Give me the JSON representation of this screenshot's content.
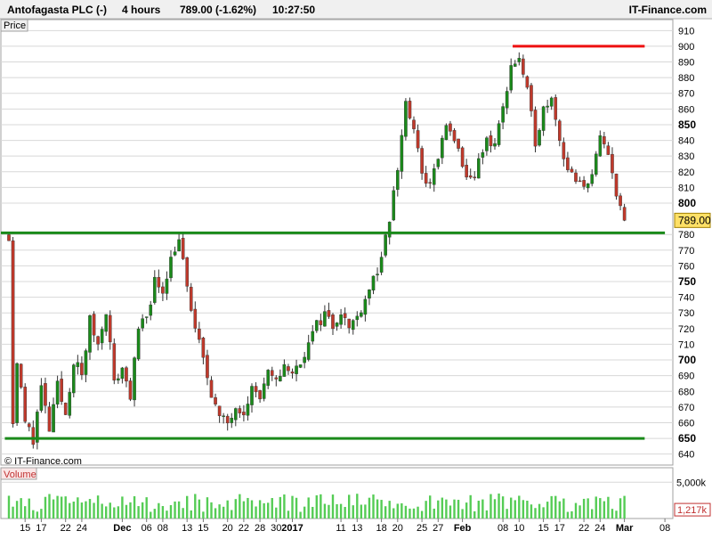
{
  "header": {
    "instrument": "Antofagasta PLC (-)",
    "timeframe": "4 hours",
    "quote": "789.00 (-1.62%)",
    "time": "10:27:50",
    "brand": "IT-Finance.com"
  },
  "watermark": "© IT-Finance.com",
  "colors": {
    "up_candle": "#1a8a1a",
    "down_candle": "#c0392b",
    "support_line": "#1a8a1a",
    "resistance_line": "#ee1111",
    "volume_bar": "#55cc55",
    "grid": "#d8d8d8",
    "axis_text": "#000000"
  },
  "chart_data": [
    {
      "type": "candlestick",
      "name": "price-panel",
      "panel_label": "Price",
      "ylim": [
        633,
        917
      ],
      "y_ticks": [
        640,
        650,
        660,
        670,
        680,
        690,
        700,
        710,
        720,
        730,
        740,
        750,
        760,
        770,
        780,
        789,
        800,
        810,
        820,
        830,
        840,
        850,
        860,
        870,
        880,
        890,
        900,
        910
      ],
      "y_major_ticks": [
        650,
        700,
        750,
        800,
        850
      ],
      "x_ticks": [
        {
          "label": "15",
          "session": 2
        },
        {
          "label": "17",
          "session": 4
        },
        {
          "label": "22",
          "session": 7
        },
        {
          "label": "24",
          "session": 9
        },
        {
          "label": "Dec",
          "session": 14,
          "bold": true
        },
        {
          "label": "06",
          "session": 17
        },
        {
          "label": "08",
          "session": 19
        },
        {
          "label": "13",
          "session": 22
        },
        {
          "label": "15",
          "session": 24
        },
        {
          "label": "20",
          "session": 27
        },
        {
          "label": "22",
          "session": 29
        },
        {
          "label": "28",
          "session": 31
        },
        {
          "label": "30",
          "session": 33
        },
        {
          "label": "2017",
          "session": 35,
          "bold": true
        },
        {
          "label": "11",
          "session": 41
        },
        {
          "label": "13",
          "session": 43
        },
        {
          "label": "18",
          "session": 46
        },
        {
          "label": "20",
          "session": 48
        },
        {
          "label": "25",
          "session": 51
        },
        {
          "label": "27",
          "session": 53
        },
        {
          "label": "Feb",
          "session": 56,
          "bold": true
        },
        {
          "label": "08",
          "session": 61
        },
        {
          "label": "10",
          "session": 63
        },
        {
          "label": "15",
          "session": 66
        },
        {
          "label": "17",
          "session": 68
        },
        {
          "label": "22",
          "session": 71
        },
        {
          "label": "24",
          "session": 73
        },
        {
          "label": "Mar",
          "session": 76,
          "bold": true
        },
        {
          "label": "08",
          "session": 81
        }
      ],
      "bars_per_session": 2,
      "anchors": [
        {
          "session": 0,
          "price": 780
        },
        {
          "session": 0.5,
          "price": 660
        },
        {
          "session": 1,
          "price": 700
        },
        {
          "session": 2,
          "price": 660
        },
        {
          "session": 3,
          "price": 650
        },
        {
          "session": 4,
          "price": 682
        },
        {
          "session": 5,
          "price": 655
        },
        {
          "session": 6,
          "price": 683
        },
        {
          "session": 7,
          "price": 665
        },
        {
          "session": 8,
          "price": 700
        },
        {
          "session": 9,
          "price": 690
        },
        {
          "session": 10,
          "price": 725
        },
        {
          "session": 11,
          "price": 710
        },
        {
          "session": 12,
          "price": 733
        },
        {
          "session": 13,
          "price": 685
        },
        {
          "session": 14,
          "price": 695
        },
        {
          "session": 15,
          "price": 678
        },
        {
          "session": 16,
          "price": 718
        },
        {
          "session": 17,
          "price": 728
        },
        {
          "session": 18,
          "price": 750
        },
        {
          "session": 19,
          "price": 745
        },
        {
          "session": 20,
          "price": 765
        },
        {
          "session": 21,
          "price": 778
        },
        {
          "session": 22,
          "price": 745
        },
        {
          "session": 23,
          "price": 720
        },
        {
          "session": 24,
          "price": 700
        },
        {
          "session": 25,
          "price": 680
        },
        {
          "session": 26,
          "price": 662
        },
        {
          "session": 27,
          "price": 660
        },
        {
          "session": 28,
          "price": 672
        },
        {
          "session": 29,
          "price": 668
        },
        {
          "session": 30,
          "price": 682
        },
        {
          "session": 31,
          "price": 676
        },
        {
          "session": 32,
          "price": 690
        },
        {
          "session": 33,
          "price": 685
        },
        {
          "session": 34,
          "price": 698
        },
        {
          "session": 35,
          "price": 690
        },
        {
          "session": 36,
          "price": 700
        },
        {
          "session": 37,
          "price": 710
        },
        {
          "session": 38,
          "price": 722
        },
        {
          "session": 39,
          "price": 730
        },
        {
          "session": 40,
          "price": 722
        },
        {
          "session": 41,
          "price": 732
        },
        {
          "session": 42,
          "price": 720
        },
        {
          "session": 43,
          "price": 728
        },
        {
          "session": 44,
          "price": 740
        },
        {
          "session": 45,
          "price": 752
        },
        {
          "session": 46,
          "price": 762
        },
        {
          "session": 47,
          "price": 790
        },
        {
          "session": 48,
          "price": 822
        },
        {
          "session": 49,
          "price": 865
        },
        {
          "session": 50,
          "price": 845
        },
        {
          "session": 51,
          "price": 820
        },
        {
          "session": 52,
          "price": 810
        },
        {
          "session": 53,
          "price": 830
        },
        {
          "session": 54,
          "price": 848
        },
        {
          "session": 55,
          "price": 842
        },
        {
          "session": 56,
          "price": 820
        },
        {
          "session": 57,
          "price": 815
        },
        {
          "session": 58,
          "price": 825
        },
        {
          "session": 59,
          "price": 840
        },
        {
          "session": 60,
          "price": 838
        },
        {
          "session": 61,
          "price": 860
        },
        {
          "session": 62,
          "price": 888
        },
        {
          "session": 63,
          "price": 892
        },
        {
          "session": 64,
          "price": 870
        },
        {
          "session": 65,
          "price": 840
        },
        {
          "session": 66,
          "price": 860
        },
        {
          "session": 67,
          "price": 870
        },
        {
          "session": 68,
          "price": 840
        },
        {
          "session": 69,
          "price": 822
        },
        {
          "session": 70,
          "price": 812
        },
        {
          "session": 71,
          "price": 810
        },
        {
          "session": 72,
          "price": 820
        },
        {
          "session": 73,
          "price": 840
        },
        {
          "session": 74,
          "price": 830
        },
        {
          "session": 75,
          "price": 808
        },
        {
          "session": 76,
          "price": 789
        }
      ],
      "last_price": "789.00",
      "support_lines": [
        {
          "price": 781,
          "from_session": -1,
          "to_session": 81
        },
        {
          "price": 650,
          "from_session": -0.5,
          "to_session": 78.5
        }
      ],
      "resistance_lines": [
        {
          "price": 900,
          "from_session": 62.2,
          "to_session": 78.5
        }
      ]
    },
    {
      "type": "bar",
      "name": "volume-panel",
      "panel_label": "Volume",
      "y_ticks": [
        {
          "label": "5,000k",
          "value": 5000
        }
      ],
      "last_value": "1,217k",
      "ylim": [
        0,
        7000
      ]
    }
  ]
}
